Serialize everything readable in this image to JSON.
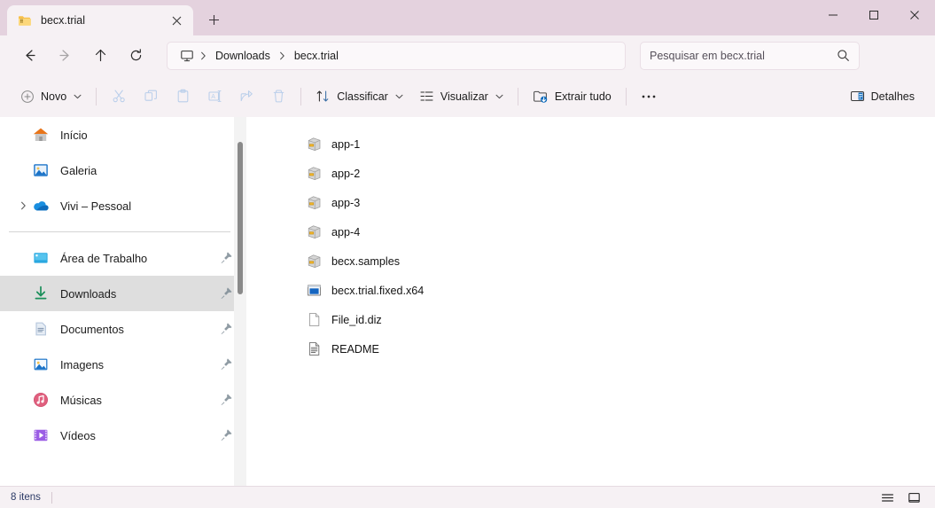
{
  "window": {
    "tab": {
      "title": "becx.trial",
      "icon": "zipped-folder-icon",
      "close_label": "✕"
    },
    "new_tab_label": "+",
    "controls": {
      "minimize": "minimize-icon",
      "maximize": "maximize-icon",
      "close": "close-icon"
    },
    "titlebar_color": "#e4d2de",
    "chrome_color": "#f6f1f4"
  },
  "nav": {
    "back": "back-arrow-icon",
    "forward": "forward-arrow-icon",
    "up": "up-arrow-icon",
    "refresh": "refresh-icon",
    "breadcrumb": {
      "root_icon": "this-pc-monitor-icon",
      "items": [
        "Downloads",
        "becx.trial"
      ],
      "separator": "›"
    }
  },
  "search": {
    "placeholder": "Pesquisar em becx.trial",
    "icon": "search-icon"
  },
  "toolbar": {
    "new_label": "Novo",
    "cut_label": "Recortar",
    "copy_label": "Copiar",
    "paste_label": "Colar",
    "rename_label": "Renomear",
    "share_label": "Compartilhar",
    "delete_label": "Excluir",
    "sort_label": "Classificar",
    "view_label": "Visualizar",
    "extract_label": "Extrair tudo",
    "more_label": "···",
    "details_label": "Detalhes"
  },
  "sidebar": {
    "items": [
      {
        "label": "Início",
        "icon": "home-icon",
        "pinned": false,
        "expandable": false,
        "selected": false
      },
      {
        "label": "Galeria",
        "icon": "gallery-icon",
        "pinned": false,
        "expandable": false,
        "selected": false
      },
      {
        "label": "Vivi – Pessoal",
        "icon": "onedrive-icon",
        "pinned": false,
        "expandable": true,
        "selected": false
      }
    ],
    "pinned_items": [
      {
        "label": "Área de Trabalho",
        "icon": "desktop-icon",
        "pinned": true,
        "selected": false
      },
      {
        "label": "Downloads",
        "icon": "downloads-icon",
        "pinned": true,
        "selected": true
      },
      {
        "label": "Documentos",
        "icon": "documents-icon",
        "pinned": true,
        "selected": false
      },
      {
        "label": "Imagens",
        "icon": "pictures-icon",
        "pinned": true,
        "selected": false
      },
      {
        "label": "Músicas",
        "icon": "music-icon",
        "pinned": true,
        "selected": false
      },
      {
        "label": "Vídeos",
        "icon": "videos-icon",
        "pinned": true,
        "selected": false
      }
    ]
  },
  "files": [
    {
      "name": "app-1",
      "icon": "cabinet-package-icon"
    },
    {
      "name": "app-2",
      "icon": "cabinet-package-icon"
    },
    {
      "name": "app-3",
      "icon": "cabinet-package-icon"
    },
    {
      "name": "app-4",
      "icon": "cabinet-package-icon"
    },
    {
      "name": "becx.samples",
      "icon": "cabinet-package-icon"
    },
    {
      "name": "becx.trial.fixed.x64",
      "icon": "executable-icon"
    },
    {
      "name": "File_id.diz",
      "icon": "blank-document-icon"
    },
    {
      "name": "README",
      "icon": "text-document-icon"
    }
  ],
  "status": {
    "item_count": "8 itens",
    "list_view_label": "Detalhes",
    "tile_view_label": "Ícones grandes"
  }
}
